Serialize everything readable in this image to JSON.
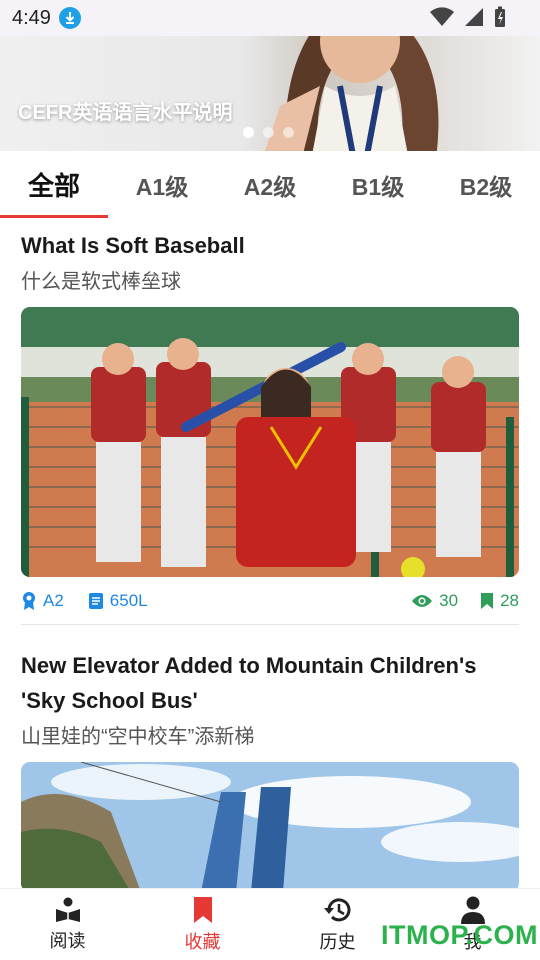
{
  "status_bar": {
    "time": "4:49"
  },
  "banner": {
    "title": "CEFR英语语言水平说明",
    "dots": 3,
    "active_dot": 0
  },
  "tabs": [
    {
      "label": "全部",
      "active": true
    },
    {
      "label": "A1级",
      "active": false
    },
    {
      "label": "A2级",
      "active": false
    },
    {
      "label": "B1级",
      "active": false
    },
    {
      "label": "B2级",
      "active": false
    }
  ],
  "articles": [
    {
      "title": "What Is Soft Baseball",
      "subtitle": "什么是软式棒垒球",
      "level": "A2",
      "lexile": "650L",
      "views": "30",
      "saves": "28"
    },
    {
      "title": "New Elevator Added to Mountain Children's 'Sky School Bus'",
      "subtitle": "山里娃的“空中校车”添新梯"
    }
  ],
  "bottom_nav": [
    {
      "label": "阅读",
      "icon": "reader-icon",
      "active": false
    },
    {
      "label": "收藏",
      "icon": "bookmark-icon",
      "active": true
    },
    {
      "label": "历史",
      "icon": "history-icon",
      "active": false
    },
    {
      "label": "我",
      "icon": "person-icon",
      "active": false
    }
  ],
  "watermark": "ITMOP.COM",
  "colors": {
    "accent": "#e53935",
    "meta_blue": "#1e88e5",
    "meta_green": "#2e9e5b"
  }
}
